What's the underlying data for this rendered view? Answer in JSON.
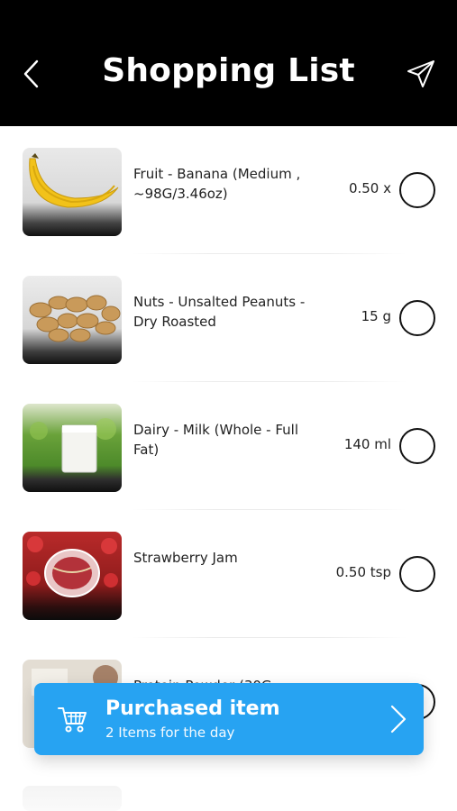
{
  "header": {
    "title": "Shopping List",
    "back_icon": "chevron-left-icon",
    "send_icon": "paper-plane-icon"
  },
  "items": [
    {
      "name": "Fruit - Banana (Medium , ~98G/3.46oz)",
      "quantity": "0.50 x",
      "image": "banana"
    },
    {
      "name": "Nuts - Unsalted Peanuts - Dry Roasted",
      "quantity": "15 g",
      "image": "peanuts"
    },
    {
      "name": "Dairy - Milk (Whole - Full Fat)",
      "quantity": "140 ml",
      "image": "milk"
    },
    {
      "name": "Strawberry Jam",
      "quantity": "0.50 tsp",
      "image": "strawberry-jam"
    },
    {
      "name": "Protein Powder (30G",
      "quantity": "",
      "image": "protein-powder"
    }
  ],
  "purchased_bar": {
    "title": "Purchased item",
    "subtitle": "2 Items for the day",
    "icon": "shopping-cart-icon",
    "chevron": "chevron-right-icon"
  },
  "colors": {
    "header_bg": "#000000",
    "accent": "#27a3f2"
  }
}
